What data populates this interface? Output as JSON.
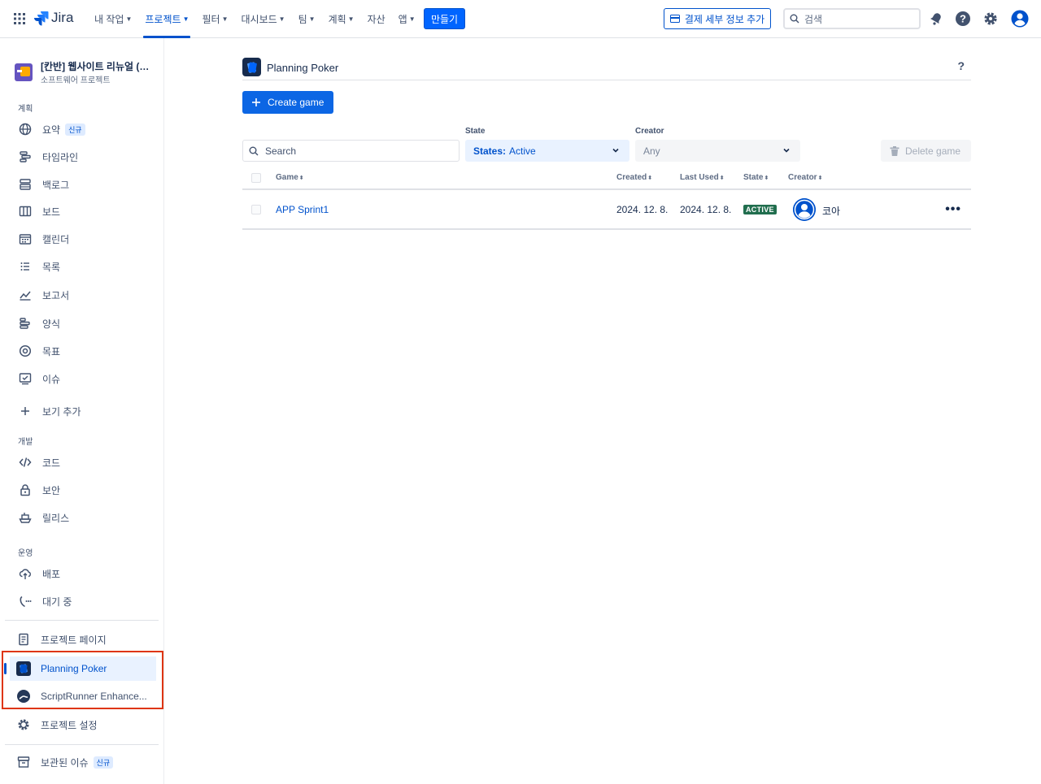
{
  "topnav": {
    "logo_text": "Jira",
    "items": [
      {
        "label": "내 작업",
        "has_dropdown": true
      },
      {
        "label": "프로젝트",
        "has_dropdown": true,
        "active": true
      },
      {
        "label": "필터",
        "has_dropdown": true
      },
      {
        "label": "대시보드",
        "has_dropdown": true
      },
      {
        "label": "팀",
        "has_dropdown": true
      },
      {
        "label": "계획",
        "has_dropdown": true
      },
      {
        "label": "자산",
        "has_dropdown": false
      },
      {
        "label": "앱",
        "has_dropdown": true
      }
    ],
    "create_label": "만들기",
    "billing_label": "결제 세부 정보 추가",
    "search_placeholder": "검색",
    "icons": [
      "app-switcher-icon",
      "notification-icon",
      "help-icon",
      "settings-icon",
      "profile-icon"
    ]
  },
  "sidebar": {
    "project_title": "[칸반] 웹사이트 리뉴얼 (팀...",
    "project_subtitle": "소프트웨어 프로젝트",
    "section_plan": "계획",
    "plan_items": [
      {
        "label": "요약",
        "badge": "신규",
        "icon": "globe-icon"
      },
      {
        "label": "타임라인",
        "icon": "timeline-icon"
      },
      {
        "label": "백로그",
        "icon": "backlog-icon"
      },
      {
        "label": "보드",
        "icon": "board-icon"
      },
      {
        "label": "캘린더",
        "icon": "calendar-icon"
      },
      {
        "label": "목록",
        "icon": "list-icon"
      },
      {
        "label": "보고서",
        "icon": "reports-icon"
      },
      {
        "label": "양식",
        "icon": "forms-icon"
      },
      {
        "label": "목표",
        "icon": "goals-icon"
      },
      {
        "label": "이슈",
        "icon": "issues-icon"
      }
    ],
    "add_view_label": "보기 추가",
    "section_dev": "개발",
    "dev_items": [
      {
        "label": "코드",
        "icon": "code-icon"
      },
      {
        "label": "보안",
        "icon": "lock-icon"
      },
      {
        "label": "릴리스",
        "icon": "ship-icon"
      }
    ],
    "section_ops": "운영",
    "ops_items": [
      {
        "label": "배포",
        "icon": "cloud-upload-icon"
      },
      {
        "label": "대기 중",
        "icon": "on-call-icon"
      }
    ],
    "project_pages_label": "프로젝트 페이지",
    "apps": [
      {
        "label": "Planning Poker",
        "selected": true
      },
      {
        "label": "ScriptRunner Enhance..."
      }
    ],
    "project_settings_label": "프로젝트 설정",
    "archived_label": "보관된 이슈",
    "archived_badge": "신규"
  },
  "main": {
    "app_title": "Planning Poker",
    "help_label": "?",
    "create_game_label": "Create game",
    "filters": {
      "search_placeholder": "Search",
      "state_label": "State",
      "state_prefix": "States:",
      "state_value": "Active",
      "creator_label": "Creator",
      "creator_value": "Any"
    },
    "delete_label": "Delete game",
    "table": {
      "columns": [
        "Game",
        "Created",
        "Last Used",
        "State",
        "Creator"
      ],
      "rows": [
        {
          "game": "APP Sprint1",
          "created": "2024. 12. 8.",
          "last_used": "2024. 12. 8.",
          "state": "ACTIVE",
          "creator": "코아"
        }
      ]
    }
  },
  "colors": {
    "accent": "#0052cc",
    "primary_button": "#0c66e4",
    "active_lozenge": "#216e4e",
    "highlight_border": "#de350b"
  }
}
